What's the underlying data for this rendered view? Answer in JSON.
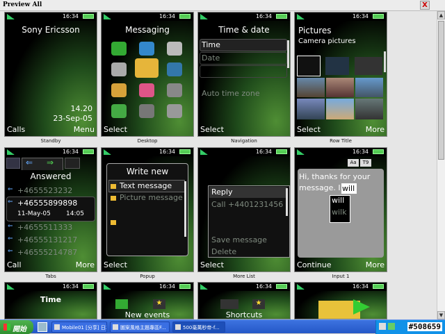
{
  "window": {
    "title": "Preview All",
    "close": "X"
  },
  "phones": {
    "standby": {
      "time": "16:34",
      "title": "Sony Ericsson",
      "clock": "14.20",
      "date": "23-Sep-05",
      "left": "Calls",
      "right": "Menu",
      "caption": "Standby"
    },
    "desktop": {
      "time": "16:34",
      "title": "Messaging",
      "left": "Select",
      "caption": "Desktop"
    },
    "navigation": {
      "time": "16:34",
      "title": "Time & date",
      "items": [
        "Time",
        "Date",
        "",
        "Auto time zone"
      ],
      "left": "Select",
      "caption": "Navigation"
    },
    "rowtitle": {
      "time": "16:34",
      "title": "Pictures",
      "subtitle": "Camera pictures",
      "left": "Select",
      "right": "More",
      "caption": "Row Title"
    },
    "tabs": {
      "time": "16:34",
      "title": "Answered",
      "numbers": [
        "+4655523232",
        "+46555899898",
        "+4655511333",
        "+46555131217",
        "+46555214787"
      ],
      "detail_date": "11-May-05",
      "detail_time": "14:05",
      "left": "Call",
      "right": "More",
      "caption": "Tabs"
    },
    "popup": {
      "time": "16:34",
      "title": "Write new",
      "items": [
        "Text message",
        "Picture message"
      ],
      "left": "Select",
      "caption": "Popup"
    },
    "morelist": {
      "time": "16:34",
      "items": [
        "Reply",
        "Call +4401231456",
        "",
        "",
        "Save message",
        "Delete"
      ],
      "left": "Select",
      "caption": "More List"
    },
    "input": {
      "time": "16:34",
      "mode1": "Aa",
      "mode2": "T9",
      "text": "Hi, thanks for your message. I",
      "word": "will",
      "suggestions": [
        "will",
        "wilk"
      ],
      "left": "Continue",
      "right": "More",
      "caption": "Input 1"
    },
    "row3a": {
      "time": "16:34",
      "title": "Time"
    },
    "row3b": {
      "time": "16:34",
      "title": "New events"
    },
    "row3c": {
      "time": "16:34",
      "title": "Shortcuts"
    },
    "row3d": {
      "time": "16:34"
    }
  },
  "taskbar": {
    "start": "開始",
    "tasks": [
      "Mobile01 [分享] 日本...",
      "圖案風格主題專區F...",
      "500毫萬秒帝-f..."
    ],
    "clock": "#508659"
  }
}
